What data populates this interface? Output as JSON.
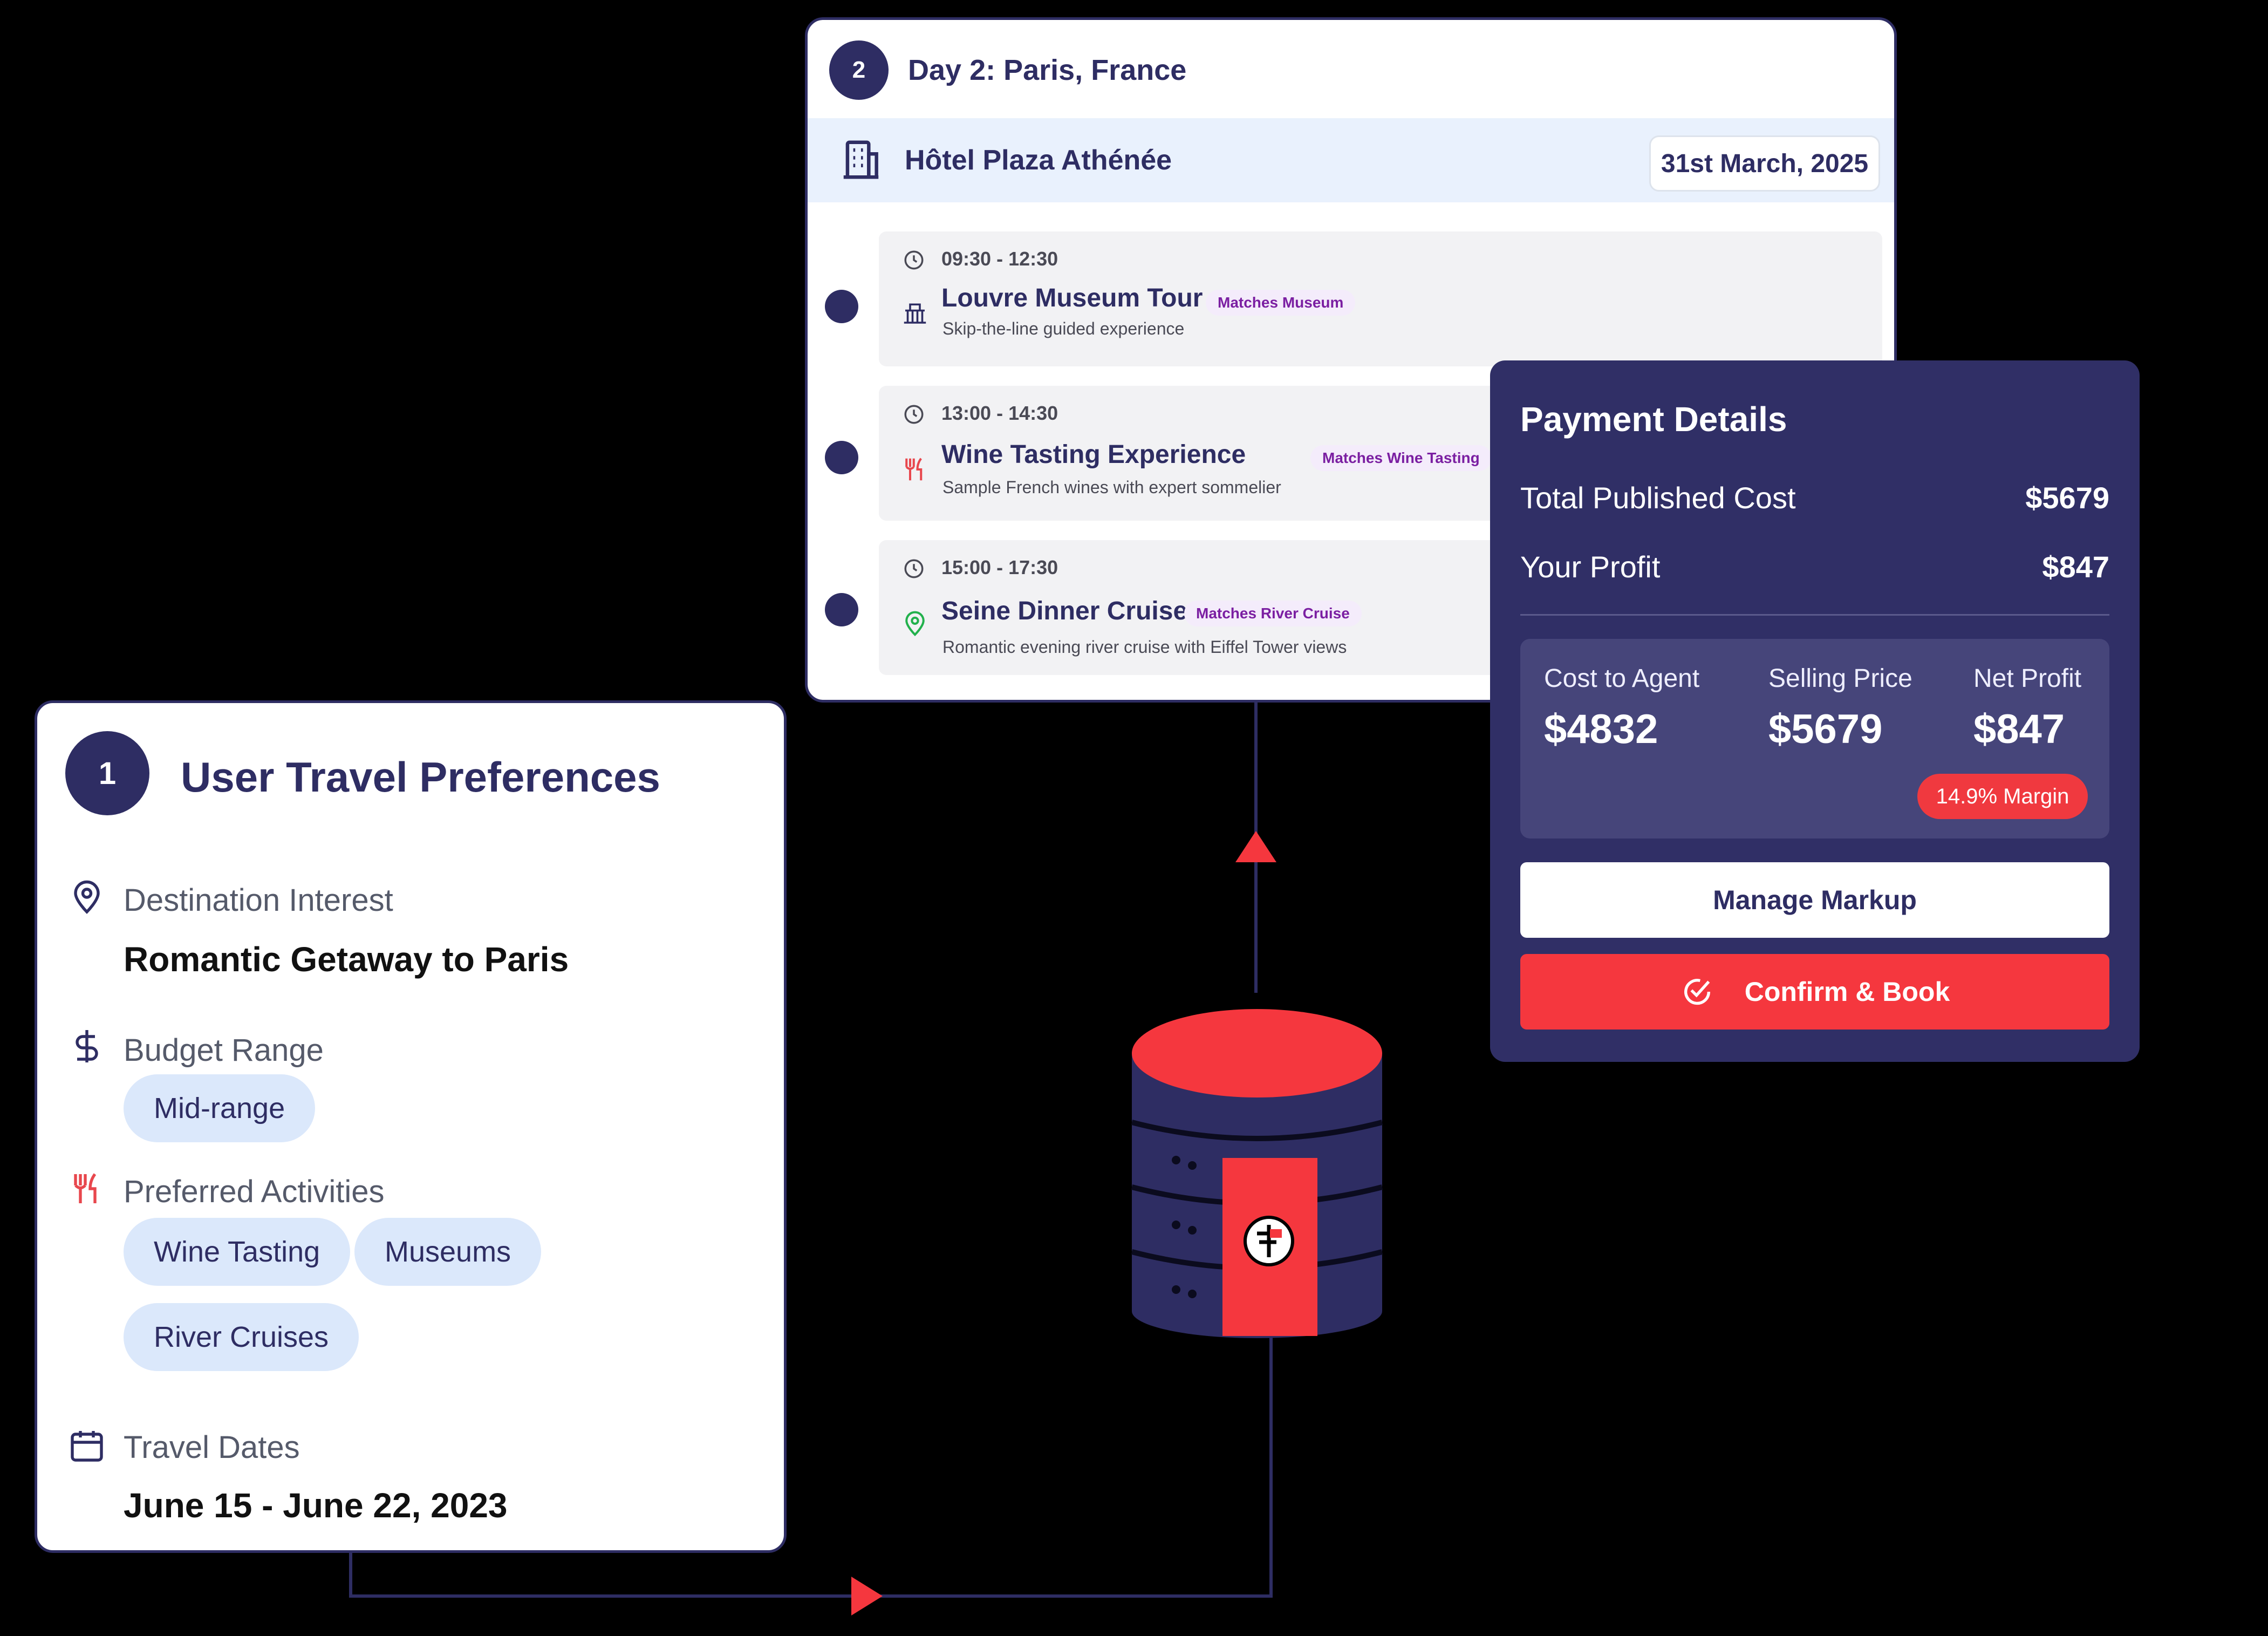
{
  "day": {
    "number": "2",
    "title": "Day 2: Paris, France",
    "hotel": "Hôtel Plaza Athénée",
    "date": "31st March, 2025",
    "activities": [
      {
        "time": "09:30 - 12:30",
        "title": "Louvre Museum Tour",
        "match": "Matches Museum",
        "desc": "Skip-the-line guided experience",
        "icon": "museum-icon"
      },
      {
        "time": "13:00 - 14:30",
        "title": "Wine Tasting Experience",
        "match": "Matches Wine Tasting",
        "desc": "Sample French wines with expert sommelier",
        "icon": "utensils-icon"
      },
      {
        "time": "15:00 - 17:30",
        "title": "Seine Dinner Cruise",
        "match": "Matches River Cruise",
        "desc": "Romantic evening river cruise with Eiffel Tower views",
        "icon": "map-pin-icon"
      }
    ]
  },
  "payment": {
    "title": "Payment Details",
    "total_label": "Total Published Cost",
    "total_value": "$5679",
    "profit_label": "Your Profit",
    "profit_value": "$847",
    "cost_agent_label": "Cost to Agent",
    "cost_agent_value": "$4832",
    "selling_label": "Selling Price",
    "selling_value": "$5679",
    "net_label": "Net Profit",
    "net_value": "$847",
    "margin": "14.9% Margin",
    "markup_button": "Manage Markup",
    "book_button": "Confirm & Book"
  },
  "preferences": {
    "number": "1",
    "title": "User Travel Preferences",
    "destination_label": "Destination Interest",
    "destination_value": "Romantic Getaway to Paris",
    "budget_label": "Budget Range",
    "budget_chip": "Mid-range",
    "activities_label": "Preferred Activities",
    "activity_chips": [
      "Wine Tasting",
      "Museums",
      "River Cruises"
    ],
    "dates_label": "Travel Dates",
    "dates_value": "June 15 - June 22, 2023"
  },
  "colors": {
    "navy": "#2e2d63",
    "accent_red": "#f5373e",
    "hotel_bar": "#e9f1fd",
    "chip": "#dbe8fb",
    "match_text": "#7b1fa2"
  }
}
